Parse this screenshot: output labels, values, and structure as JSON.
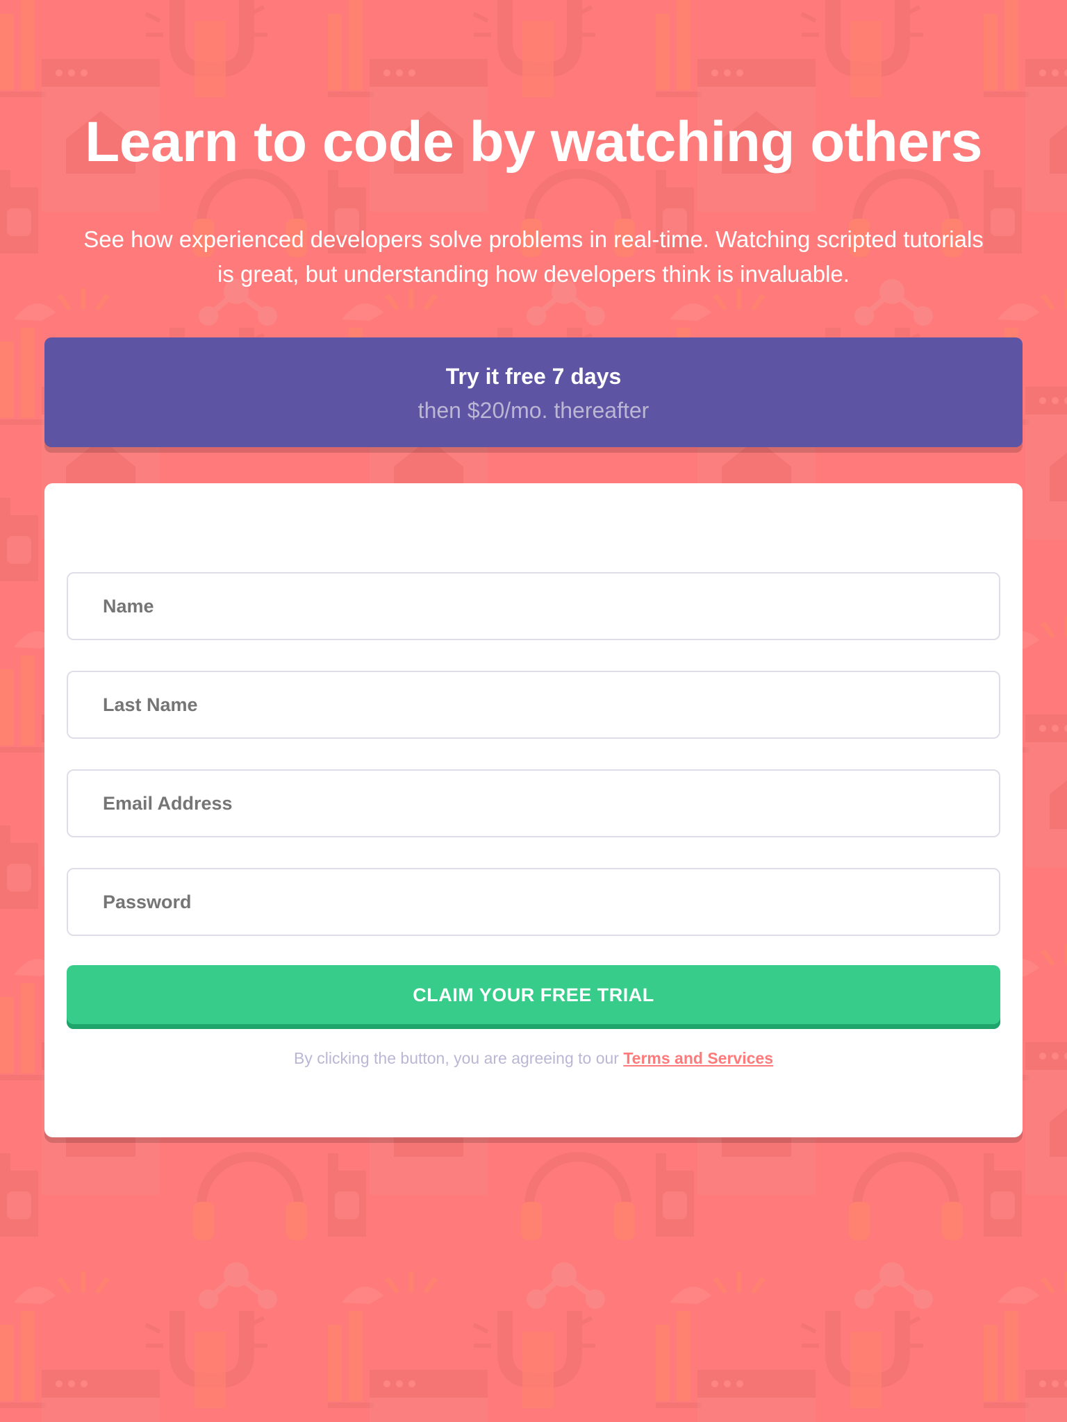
{
  "colors": {
    "background": "#ff7a7a",
    "banner": "#5e54a4",
    "banner_subtext": "#bab7d4",
    "button": "#38cc8b",
    "button_shadow": "#1fa56b",
    "link": "#ff7a7a",
    "terms_text": "#bab7d4",
    "field_border": "#dedee9"
  },
  "hero": {
    "title": "Learn to code by watching others",
    "description": "See how experienced developers solve problems in real-time. Watching scripted tutorials is great, but understanding how developers think is invaluable."
  },
  "offer": {
    "title": "Try it free 7 days",
    "price_text": "then $20/mo. thereafter"
  },
  "form": {
    "fields": [
      {
        "placeholder": "Name",
        "value": ""
      },
      {
        "placeholder": "Last Name",
        "value": ""
      },
      {
        "placeholder": "Email Address",
        "value": ""
      },
      {
        "placeholder": "Password",
        "value": ""
      }
    ],
    "submit_label": "CLAIM YOUR FREE TRIAL",
    "terms_prefix": "By clicking the button, you are agreeing to our ",
    "terms_link": "Terms and Services"
  },
  "background_icons": [
    "code-icon",
    "chart-icon",
    "browser-icon",
    "headphones-icon",
    "share-icon",
    "lightbulb-icon"
  ]
}
